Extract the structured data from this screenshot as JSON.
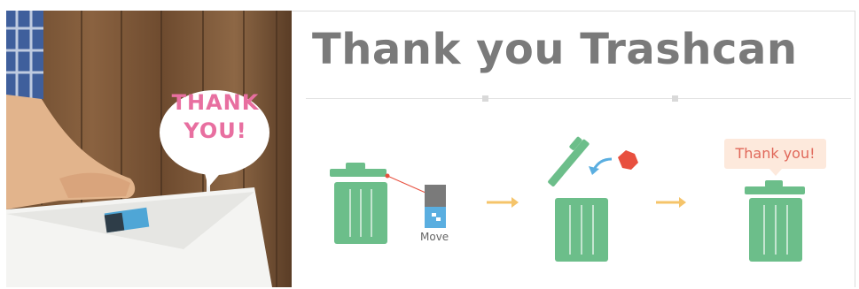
{
  "banner": {
    "title": "Thank you Trashcan",
    "sign_text": "THANK YOU!",
    "step_move_label": "Move",
    "step_final_bubble": "Thank you!"
  },
  "colors": {
    "title": "#7a7a7a",
    "trashcan_green": "#6cbe8a",
    "arrow_orange": "#f5c46a",
    "bubble_bg": "#fde9dc",
    "bubble_text": "#e0685a",
    "trash_paper_red": "#e8503f",
    "curve_arrow_blue": "#5aaee0",
    "usb_blue": "#5aaee0",
    "usb_gray": "#7a7a7a"
  },
  "icons": [
    "trashcan-icon",
    "usb-drive-icon",
    "right-arrow-icon",
    "crumpled-paper-icon",
    "curved-arrow-icon",
    "speech-bubble-icon"
  ]
}
